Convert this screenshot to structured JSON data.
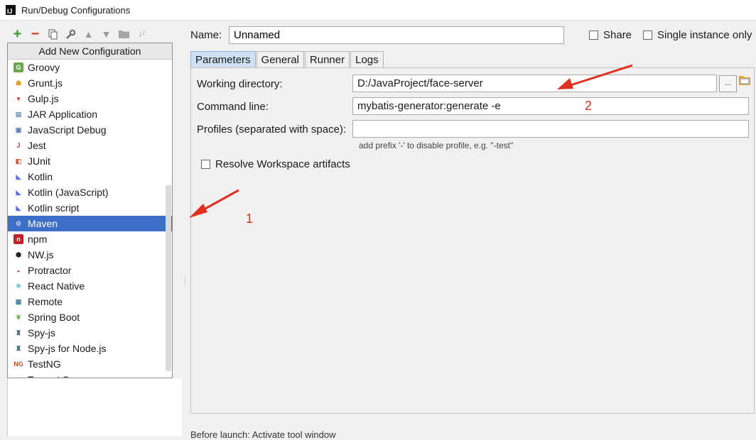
{
  "window": {
    "title": "Run/Debug Configurations"
  },
  "toolbar": {
    "add": "+",
    "remove": "−"
  },
  "add_menu": {
    "header": "Add New Configuration",
    "items": [
      {
        "label": "Groovy",
        "icon": "groovy-icon"
      },
      {
        "label": "Grunt.js",
        "icon": "grunt-icon"
      },
      {
        "label": "Gulp.js",
        "icon": "gulp-icon"
      },
      {
        "label": "JAR Application",
        "icon": "jar-icon"
      },
      {
        "label": "JavaScript Debug",
        "icon": "js-debug-icon"
      },
      {
        "label": "Jest",
        "icon": "jest-icon"
      },
      {
        "label": "JUnit",
        "icon": "junit-icon"
      },
      {
        "label": "Kotlin",
        "icon": "kotlin-icon"
      },
      {
        "label": "Kotlin (JavaScript)",
        "icon": "kotlin-icon"
      },
      {
        "label": "Kotlin script",
        "icon": "kotlin-icon"
      },
      {
        "label": "Maven",
        "icon": "maven-gear-icon"
      },
      {
        "label": "npm",
        "icon": "npm-icon"
      },
      {
        "label": "NW.js",
        "icon": "nwjs-icon"
      },
      {
        "label": "Protractor",
        "icon": "protractor-icon"
      },
      {
        "label": "React Native",
        "icon": "react-icon"
      },
      {
        "label": "Remote",
        "icon": "remote-icon"
      },
      {
        "label": "Spring Boot",
        "icon": "spring-icon"
      },
      {
        "label": "Spy-js",
        "icon": "spyjs-icon"
      },
      {
        "label": "Spy-js for Node.js",
        "icon": "spyjs-icon"
      },
      {
        "label": "TestNG",
        "icon": "testng-icon"
      },
      {
        "label": "Tomcat Server",
        "icon": "tomcat-icon"
      }
    ],
    "selected_index": 10
  },
  "config": {
    "name_label": "Name:",
    "name_value": "Unnamed",
    "share_label": "Share",
    "single_instance_label": "Single instance only"
  },
  "tabs": [
    "Parameters",
    "General",
    "Runner",
    "Logs"
  ],
  "parameters": {
    "working_dir_label": "Working directory:",
    "working_dir_value": "D:/JavaProject/face-server",
    "command_line_label": "Command line:",
    "command_line_value": "mybatis-generator:generate -e",
    "profiles_label": "Profiles (separated with space):",
    "profiles_value": "",
    "profiles_hint": "add prefix '-' to disable profile, e.g. \"-test\"",
    "resolve_label": "Resolve Workspace artifacts",
    "browse_label": "..."
  },
  "annotations": {
    "one": "1",
    "two": "2"
  },
  "before_launch": "Before launch: Activate tool window",
  "colors": {
    "selection": "#3d6fc9",
    "annotation": "#e03020",
    "active_tab": "#cfe0f3"
  }
}
